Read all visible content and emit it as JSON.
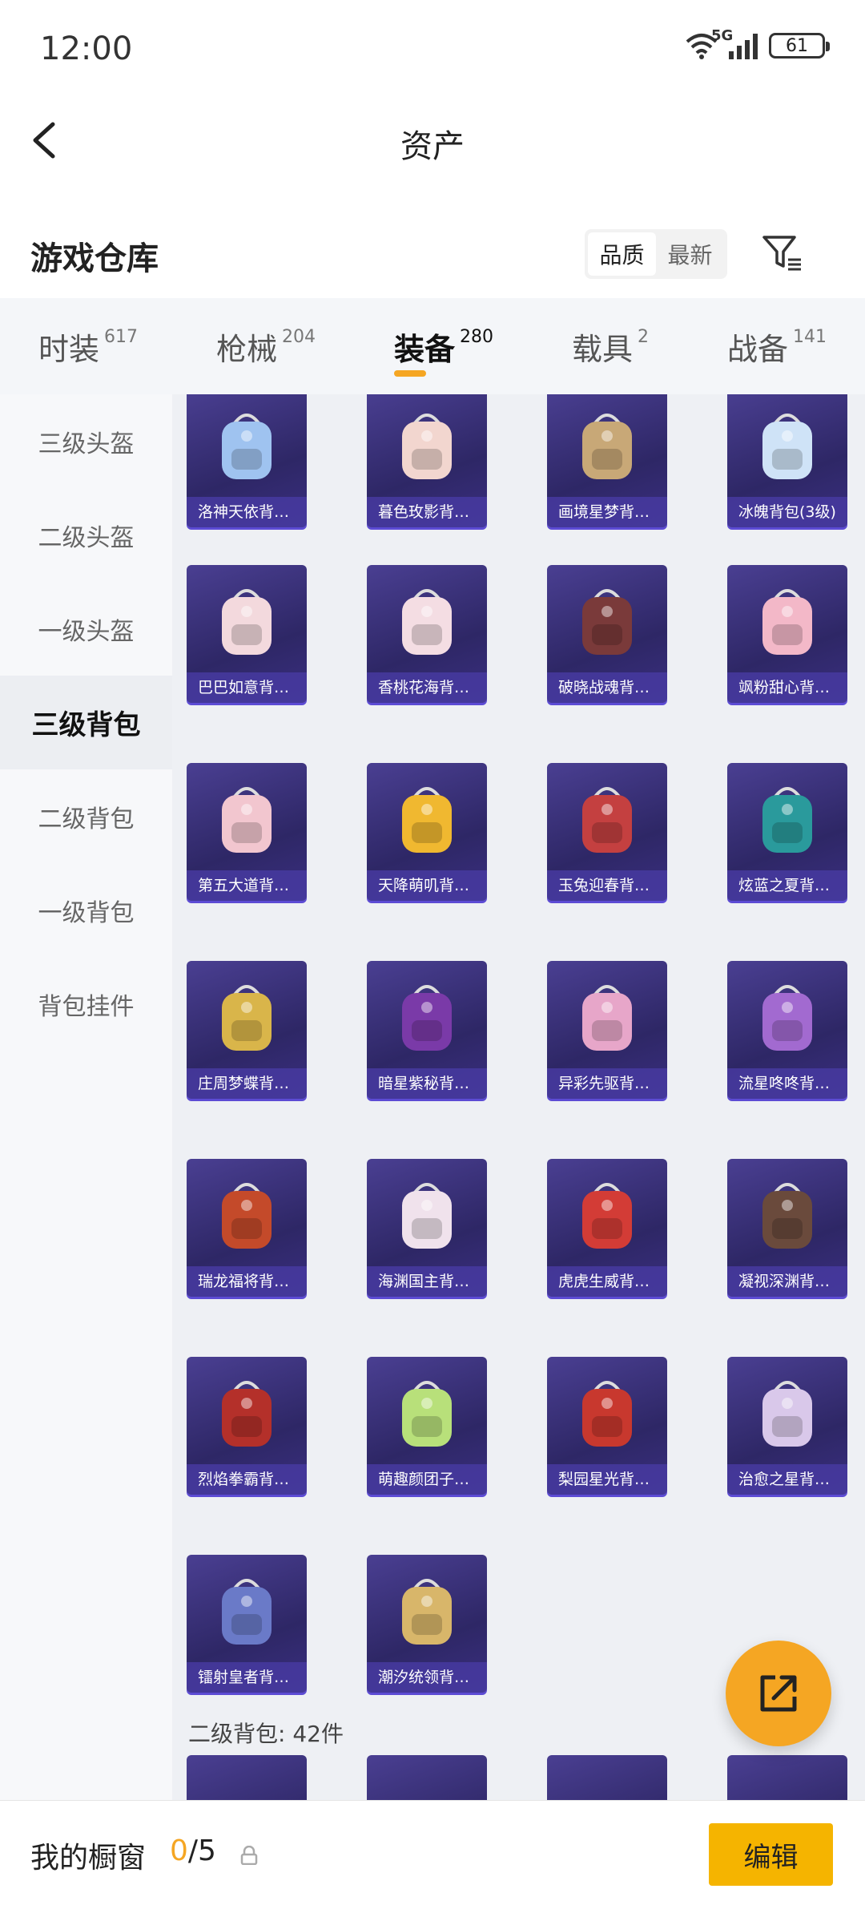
{
  "status_bar": {
    "time": "12:00",
    "network": "5G",
    "battery": "61"
  },
  "nav": {
    "title": "资产"
  },
  "sub_header": {
    "title": "游戏仓库",
    "sort_options": [
      "品质",
      "最新"
    ],
    "active_sort": "品质"
  },
  "tabs": [
    {
      "label": "时装",
      "count": "617"
    },
    {
      "label": "枪械",
      "count": "204"
    },
    {
      "label": "装备",
      "count": "280",
      "active": true
    },
    {
      "label": "载具",
      "count": "2"
    },
    {
      "label": "战备",
      "count": "141"
    }
  ],
  "sidebar": {
    "items": [
      "三级头盔",
      "二级头盔",
      "一级头盔",
      "三级背包",
      "二级背包",
      "一级背包",
      "背包挂件"
    ],
    "active": "三级背包"
  },
  "items": [
    {
      "name": "洛神天依背…",
      "color": "#9fc3f0"
    },
    {
      "name": "暮色玫影背…",
      "color": "#f2d6cf"
    },
    {
      "name": "画境星梦背…",
      "color": "#c8a877"
    },
    {
      "name": "冰魄背包(3级)",
      "color": "#cfe3f7"
    },
    {
      "name": "巴巴如意背…",
      "color": "#f3d9dd"
    },
    {
      "name": "香桃花海背…",
      "color": "#f4dde3"
    },
    {
      "name": "破晓战魂背…",
      "color": "#7a3a3a"
    },
    {
      "name": "飒粉甜心背…",
      "color": "#f3b8c8"
    },
    {
      "name": "第五大道背…",
      "color": "#f2c6cf"
    },
    {
      "name": "天降萌叽背…",
      "color": "#f0b830"
    },
    {
      "name": "玉兔迎春背…",
      "color": "#c44040"
    },
    {
      "name": "炫蓝之夏背…",
      "color": "#2a9a9c"
    },
    {
      "name": "庄周梦蝶背…",
      "color": "#d9b54a"
    },
    {
      "name": "暗星紫秘背…",
      "color": "#7a3aa8"
    },
    {
      "name": "异彩先驱背…",
      "color": "#e7a6c9"
    },
    {
      "name": "流星咚咚背…",
      "color": "#a26ad0"
    },
    {
      "name": "瑞龙福将背…",
      "color": "#c44a2a"
    },
    {
      "name": "海渊国主背…",
      "color": "#f0e2ec"
    },
    {
      "name": "虎虎生威背…",
      "color": "#d33c36"
    },
    {
      "name": "凝视深渊背…",
      "color": "#6a4a3c"
    },
    {
      "name": "烈焰拳霸背…",
      "color": "#b4302a"
    },
    {
      "name": "萌趣颜团子…",
      "color": "#b8e07a"
    },
    {
      "name": "梨园星光背…",
      "color": "#c8382e"
    },
    {
      "name": "治愈之星背…",
      "color": "#d9c8ea"
    },
    {
      "name": "镭射皇者背…",
      "color": "#6a7ac8"
    },
    {
      "name": "潮汐统领背…",
      "color": "#d8b66a"
    }
  ],
  "next_section": {
    "label": "二级背包: 42件"
  },
  "bottom_bar": {
    "label": "我的橱窗",
    "current": "0",
    "total": "/5",
    "edit_label": "编辑"
  },
  "colors": {
    "accent": "#f5a623",
    "card_bg": "#2e2766"
  }
}
